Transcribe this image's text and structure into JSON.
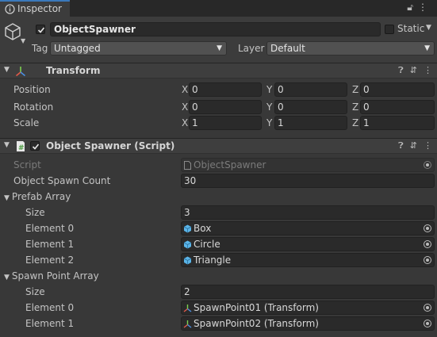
{
  "tab": {
    "label": "Inspector",
    "icons": [
      "lock-icon",
      "more-icon"
    ]
  },
  "header": {
    "name": "ObjectSpawner",
    "static_label": "Static",
    "tag_label": "Tag",
    "tag_value": "Untagged",
    "layer_label": "Layer",
    "layer_value": "Default"
  },
  "transform": {
    "title": "Transform",
    "position": {
      "label": "Position",
      "x": "0",
      "y": "0",
      "z": "0"
    },
    "rotation": {
      "label": "Rotation",
      "x": "0",
      "y": "0",
      "z": "0"
    },
    "scale": {
      "label": "Scale",
      "x": "1",
      "y": "1",
      "z": "1"
    },
    "axis_x": "X",
    "axis_y": "Y",
    "axis_z": "Z"
  },
  "script_component": {
    "title": "Object Spawner (Script)",
    "script_label": "Script",
    "script_value": "ObjectSpawner",
    "spawn_count_label": "Object Spawn Count",
    "spawn_count_value": "30",
    "prefab_array": {
      "label": "Prefab Array",
      "size_label": "Size",
      "size_value": "3",
      "elements": [
        {
          "label": "Element 0",
          "value": "Box"
        },
        {
          "label": "Element 1",
          "value": "Circle"
        },
        {
          "label": "Element 2",
          "value": "Triangle"
        }
      ]
    },
    "spawn_point_array": {
      "label": "Spawn Point Array",
      "size_label": "Size",
      "size_value": "2",
      "elements": [
        {
          "label": "Element 0",
          "value": "SpawnPoint01 (Transform)"
        },
        {
          "label": "Element 1",
          "value": "SpawnPoint02 (Transform)"
        }
      ]
    }
  },
  "colors": {
    "accent": "#3a79bb",
    "background": "#383838",
    "field": "#2a2a2a"
  }
}
